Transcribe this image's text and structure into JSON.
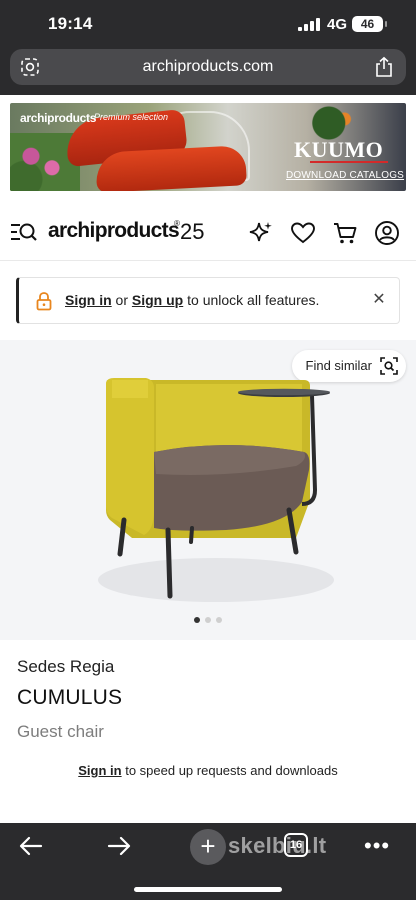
{
  "status": {
    "time": "19:14",
    "network": "4G",
    "battery": "46"
  },
  "browser": {
    "url": "archiproducts.com"
  },
  "banner": {
    "brand": "archiproducts",
    "tagline": "Premium selection",
    "logo": "KUUMO",
    "cta": "DOWNLOAD CATALOGS"
  },
  "header": {
    "logo": "archiproducts",
    "logo_mark": "®",
    "anniversary": "25"
  },
  "notice": {
    "sign_in": "Sign in",
    "or": " or ",
    "sign_up": "Sign up",
    "rest": " to unlock all features.",
    "close": "✕"
  },
  "product": {
    "find_similar": "Find similar",
    "brand": "Sedes Regia",
    "name": "CUMULUS",
    "type": "Guest chair",
    "signin_link": "Sign in",
    "signin_rest": " to speed up requests and downloads",
    "carousel": {
      "total": 3,
      "active": 1
    }
  },
  "toolbar": {
    "tabs_count": "16",
    "watermark": "skelbiu.lt",
    "more": "•••"
  },
  "colors": {
    "chrome": "#2b2b2d",
    "chair_shell": "#c9b828",
    "chair_seat": "#6b5b55",
    "stage_bg": "#f4f5f7"
  }
}
